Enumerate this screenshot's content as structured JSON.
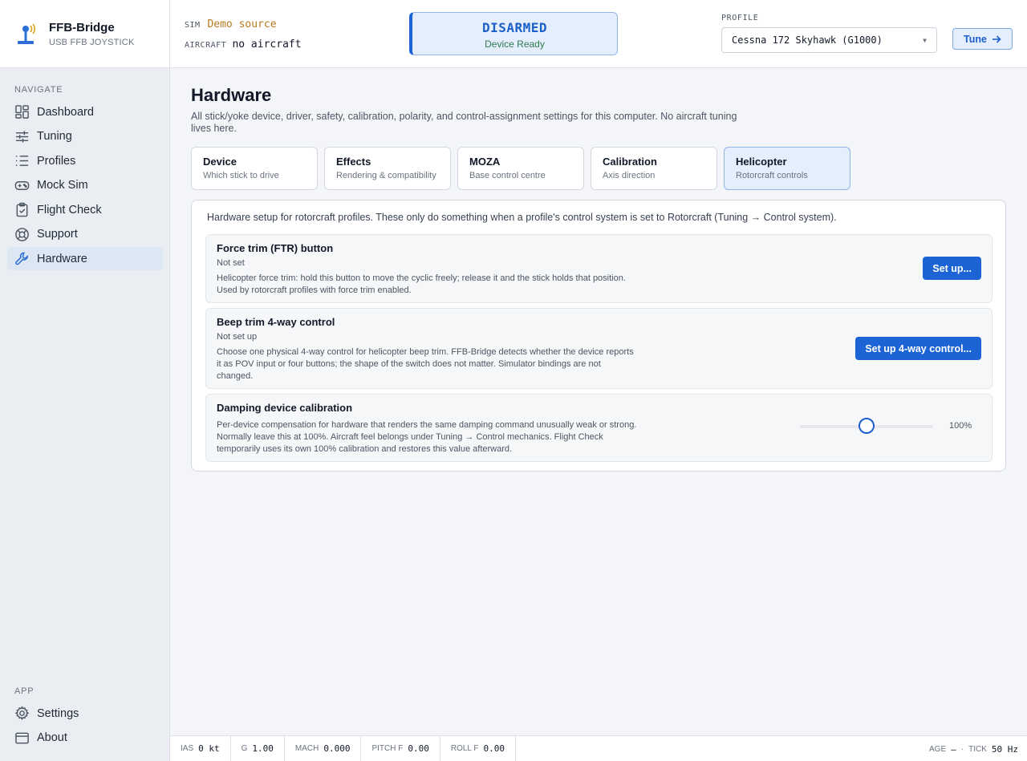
{
  "brand": {
    "name": "FFB-Bridge",
    "subtitle": "USB FFB JOYSTICK"
  },
  "nav": {
    "heading": "NAVIGATE",
    "items": [
      {
        "label": "Dashboard",
        "icon": "dashboard-icon"
      },
      {
        "label": "Tuning",
        "icon": "sliders-icon"
      },
      {
        "label": "Profiles",
        "icon": "list-icon"
      },
      {
        "label": "Mock Sim",
        "icon": "gamepad-icon"
      },
      {
        "label": "Flight Check",
        "icon": "clipboard-check-icon"
      },
      {
        "label": "Support",
        "icon": "lifebuoy-icon"
      },
      {
        "label": "Hardware",
        "icon": "wrench-icon",
        "active": true
      }
    ],
    "app_heading": "APP",
    "app_items": [
      {
        "label": "Settings",
        "icon": "gear-icon"
      },
      {
        "label": "About",
        "icon": "window-icon"
      }
    ]
  },
  "header": {
    "sim_key": "SIM",
    "sim_value": "Demo source",
    "aircraft_key": "AIRCRAFT",
    "aircraft_value": "no aircraft",
    "status_title": "DISARMED",
    "status_sub": "Device Ready",
    "profile_label": "PROFILE",
    "profile_value": "Cessna 172 Skyhawk (G1000)",
    "tune_label": "Tune"
  },
  "page": {
    "title": "Hardware",
    "description": "All stick/yoke device, driver, safety, calibration, polarity, and control-assignment settings for this computer. No aircraft tuning lives here.",
    "tabs": [
      {
        "title": "Device",
        "sub": "Which stick to drive"
      },
      {
        "title": "Effects",
        "sub": "Rendering & compatibility"
      },
      {
        "title": "MOZA",
        "sub": "Base control centre"
      },
      {
        "title": "Calibration",
        "sub": "Axis direction"
      },
      {
        "title": "Helicopter",
        "sub": "Rotorcraft controls",
        "active": true
      }
    ],
    "panel_intro": "Hardware setup for rotorcraft profiles. These only do something when a profile's control system is set to Rotorcraft (Tuning → Control system).",
    "rows": {
      "force_trim": {
        "title": "Force trim (FTR) button",
        "state": "Not set",
        "desc": "Helicopter force trim: hold this button to move the cyclic freely; release it and the stick holds that position. Used by rotorcraft profiles with force trim enabled.",
        "button": "Set up..."
      },
      "beep_trim": {
        "title": "Beep trim 4-way control",
        "state": "Not set up",
        "desc": "Choose one physical 4-way control for helicopter beep trim. FFB-Bridge detects whether the device reports it as POV input or four buttons; the shape of the switch does not matter. Simulator bindings are not changed.",
        "button": "Set up 4-way control..."
      },
      "damping": {
        "title": "Damping device calibration",
        "desc": "Per-device compensation for hardware that renders the same damping command unusually weak or strong. Normally leave this at 100%. Aircraft feel belongs under Tuning → Control mechanics. Flight Check temporarily uses its own 100% calibration and restores this value afterward.",
        "slider_fraction": 0.5,
        "value_label": "100%"
      }
    }
  },
  "footer": {
    "telemetry": [
      {
        "key": "IAS",
        "value": "0 kt"
      },
      {
        "key": "G",
        "value": "1.00"
      },
      {
        "key": "MACH",
        "value": "0.000"
      },
      {
        "key": "PITCH F",
        "value": "0.00"
      },
      {
        "key": "ROLL F",
        "value": "0.00"
      }
    ],
    "age_key": "AGE",
    "age_value": "—",
    "separator": "·",
    "tick_key": "TICK",
    "tick_value": "50 Hz"
  },
  "colors": {
    "accent": "#1c64d6",
    "sim_value": "#b7791f",
    "ready": "#2f7a4f"
  }
}
